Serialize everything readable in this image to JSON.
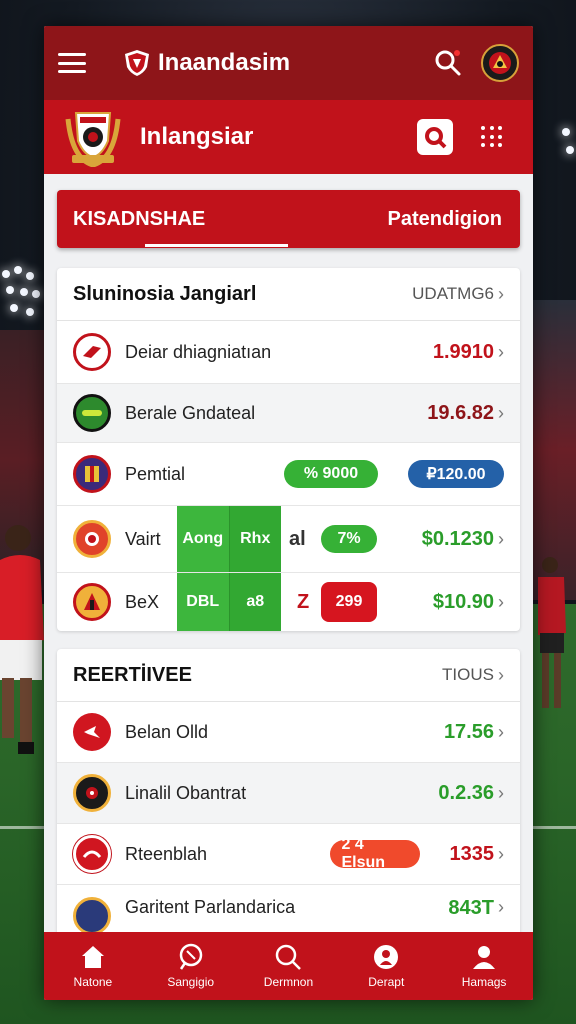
{
  "topbar": {
    "title": "Inaandasim",
    "menu_icon": "hamburger-icon",
    "search_icon": "search-icon",
    "avatar_icon": "avatar"
  },
  "header": {
    "title": "Inlangsiar",
    "action_icon": "search-card-icon",
    "grid_icon": "grid-icon"
  },
  "tabs": {
    "left": "KISADNSHAE",
    "right": "Patendigion"
  },
  "card1": {
    "title": "Sluninosia Jangiarl",
    "link": "UDATMG6",
    "rows": [
      {
        "name": "Deiar dhiagniatıan",
        "value": "1.9910"
      },
      {
        "name": "Berale Gndateal",
        "value": "19.6.82"
      },
      {
        "name": "Pemtial",
        "pill1": "% 9000",
        "pill2": "₽120.00"
      },
      {
        "name": "Vairt",
        "block1": "Aong",
        "block2": "Rhx",
        "extra": "al",
        "pill": "7%",
        "value": "$0.1230"
      },
      {
        "name": "BeX",
        "block1": "DBL",
        "block2": "a8",
        "extra": "Z",
        "pill": "299",
        "value": "$10.90"
      }
    ]
  },
  "card2": {
    "title": "REERTİIVEE",
    "link": "TIOUS",
    "rows": [
      {
        "name": "Belan Olld",
        "value": "17.56"
      },
      {
        "name": "Linalil Obantrat",
        "value": "0.2.36"
      },
      {
        "name": "Rteenblah",
        "pill": "2 4 Elsun",
        "value": "1335"
      },
      {
        "name": "Garitent Parlandarica",
        "value": "843T"
      }
    ]
  },
  "bottom_nav": [
    {
      "label": "Natone",
      "icon": "home-icon"
    },
    {
      "label": "Sangigio",
      "icon": "ball-icon"
    },
    {
      "label": "Dermnon",
      "icon": "search-icon"
    },
    {
      "label": "Derapt",
      "icon": "team-icon"
    },
    {
      "label": "Hamags",
      "icon": "profile-icon"
    }
  ],
  "colors": {
    "primary": "#c1121b",
    "primary_dark": "#8e1519",
    "positive": "#2a9d2a",
    "blue": "#2461a8",
    "orange": "#f04a2c"
  }
}
